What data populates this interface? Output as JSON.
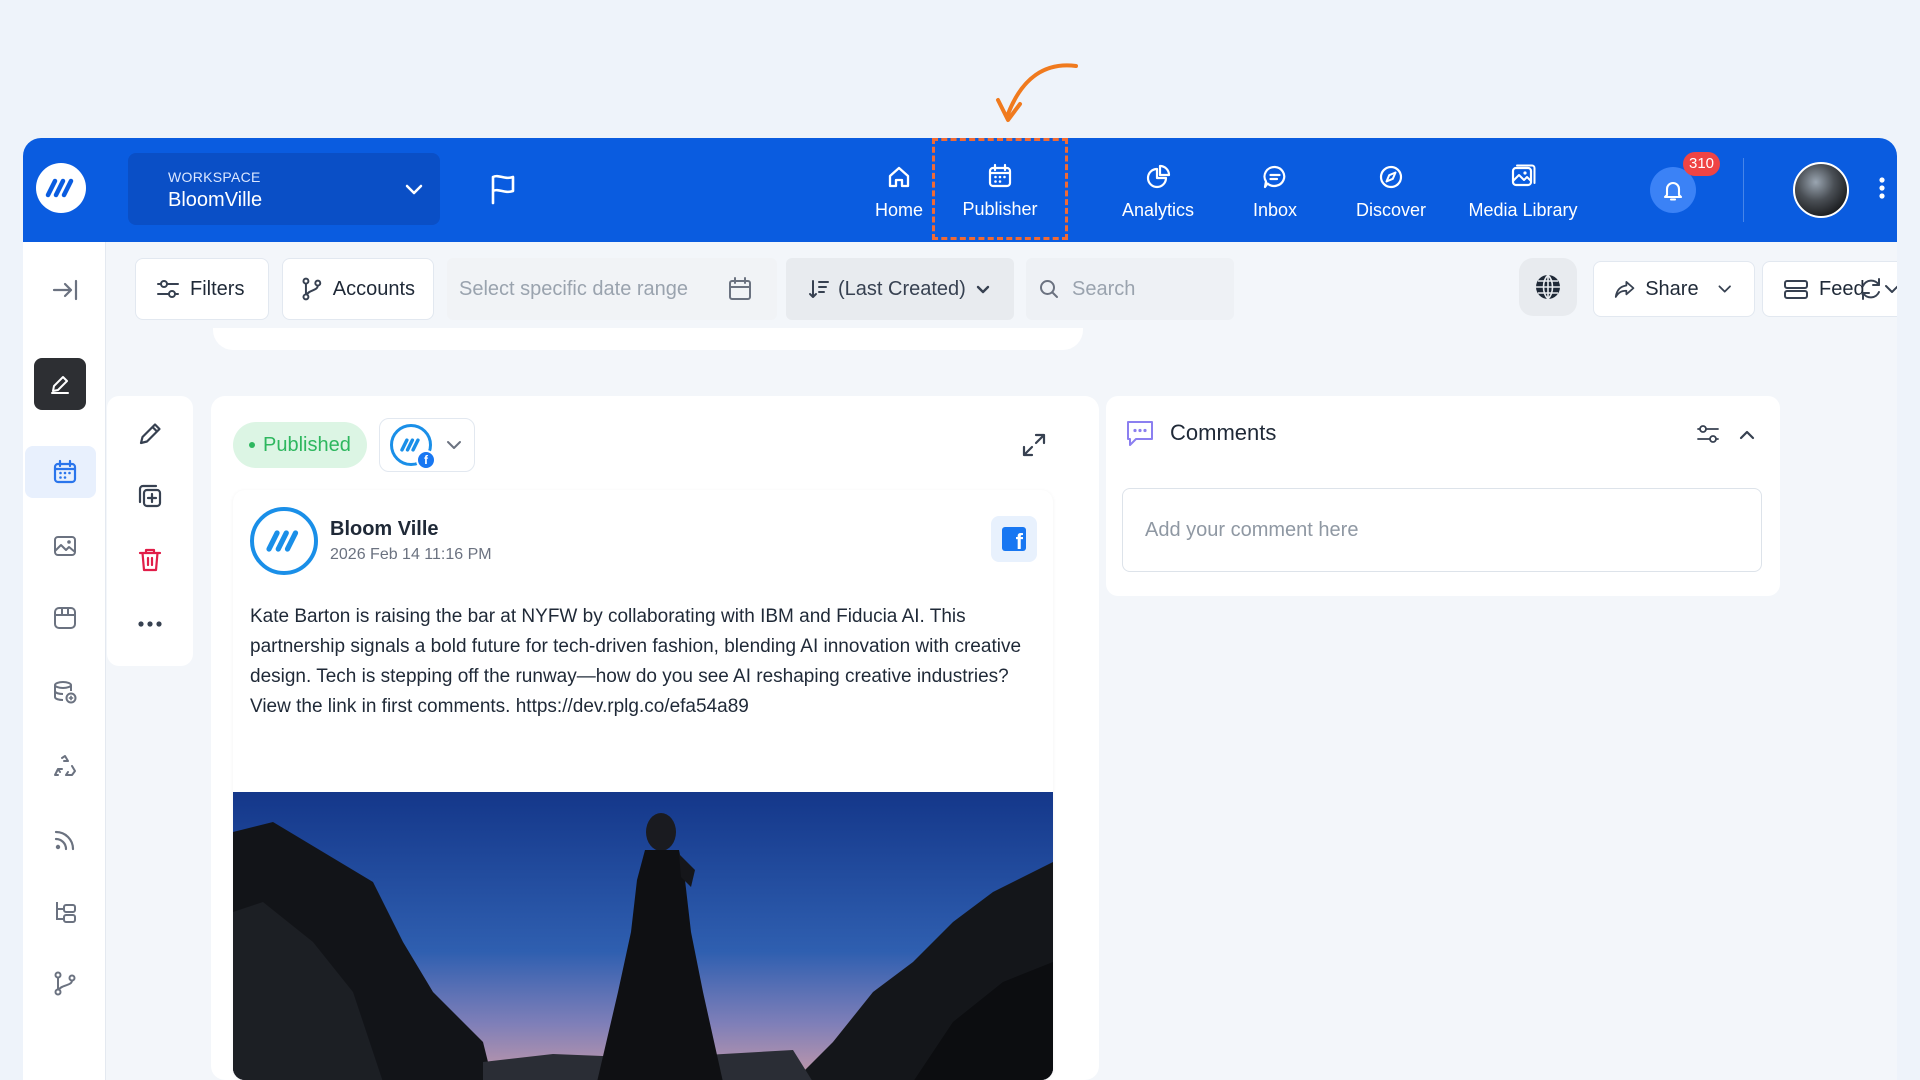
{
  "workspace": {
    "label": "WORKSPACE",
    "name": "BloomVille"
  },
  "nav": {
    "home": "Home",
    "publisher": "Publisher",
    "analytics": "Analytics",
    "inbox": "Inbox",
    "discover": "Discover",
    "media_library": "Media Library"
  },
  "notifications": {
    "count": "310"
  },
  "toolbar": {
    "filters": "Filters",
    "accounts": "Accounts",
    "date_placeholder": "Select specific date range",
    "sort": "(Last Created)",
    "search_placeholder": "Search",
    "share": "Share",
    "feed": "Feed"
  },
  "post": {
    "status": "Published",
    "account_name": "Bloom Ville",
    "date": "2026 Feb 14 11:16 PM",
    "text": "Kate Barton is raising the bar at NYFW by collaborating with IBM and Fiducia AI. This partnership signals a bold future for tech-driven fashion, blending AI innovation with creative design. Tech is stepping off the runway—how do you see AI reshaping creative industries? View the link in first comments. https://dev.rplg.co/efa54a89"
  },
  "comments": {
    "title": "Comments",
    "placeholder": "Add your comment here"
  },
  "colors": {
    "brand": "#0a5ce0",
    "highlight_dashed": "#f06a35",
    "published_green": "#2eb75f",
    "badge_red": "#ef4444",
    "delete_red": "#e11d48"
  },
  "icons": [
    "logo-icon",
    "flag-icon",
    "home-icon",
    "calendar-icon",
    "analytics-icon",
    "inbox-icon",
    "compass-icon",
    "media-icon",
    "bell-icon",
    "kebab-icon",
    "collapse-icon",
    "pen-icon",
    "copy-add-icon",
    "trash-icon",
    "more-icon",
    "globe-icon",
    "share-icon",
    "feed-icon",
    "refresh-icon",
    "expand-icon",
    "facebook-icon",
    "comment-icon"
  ]
}
